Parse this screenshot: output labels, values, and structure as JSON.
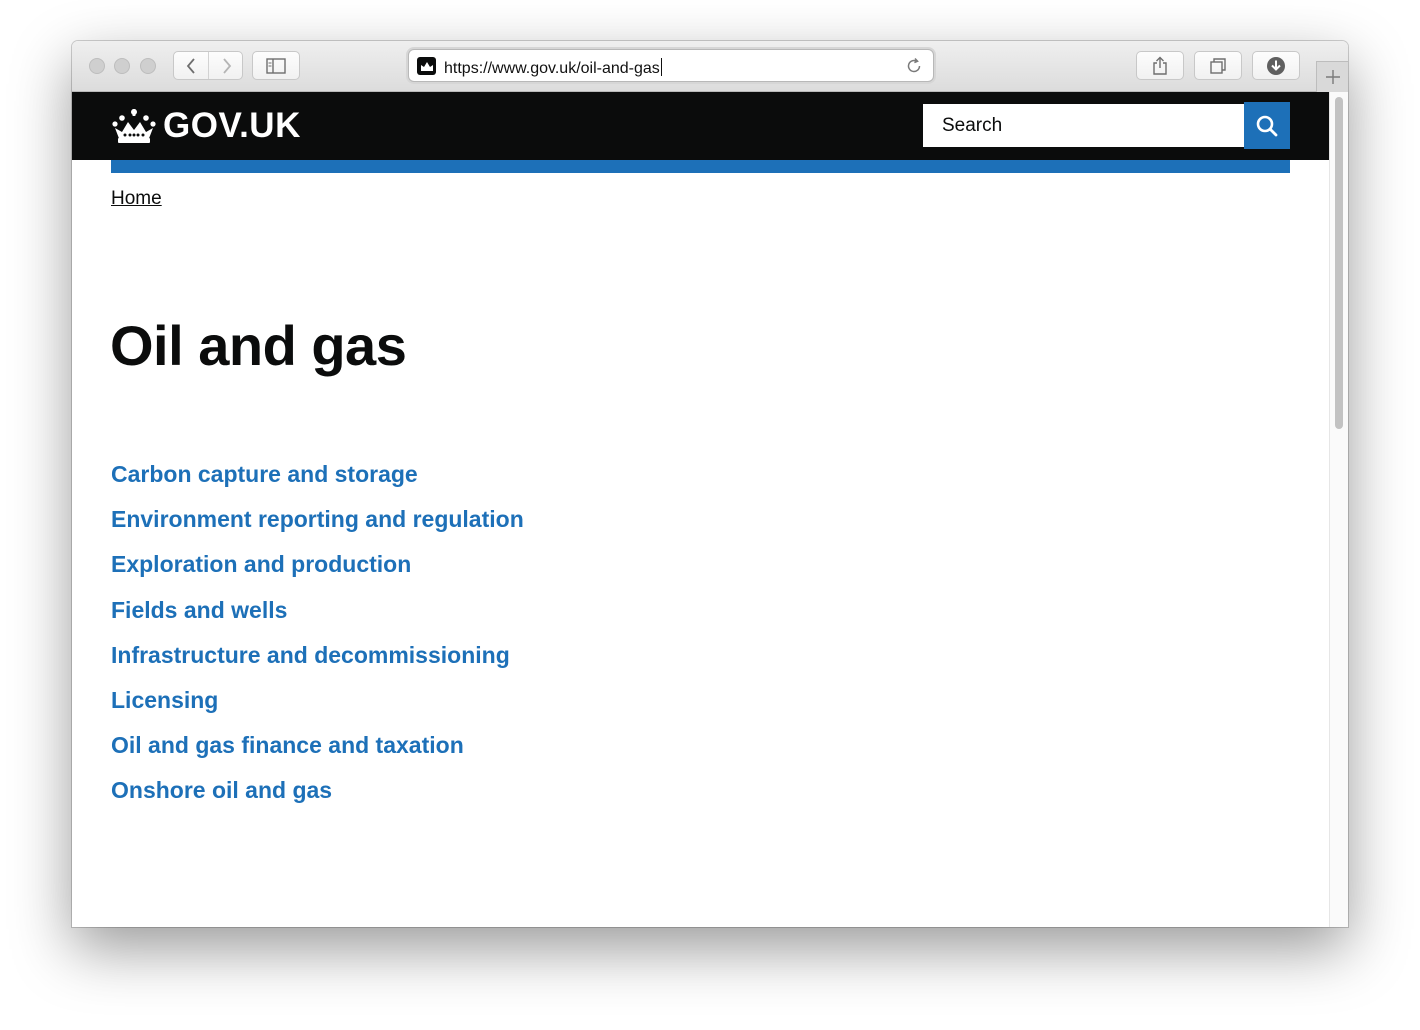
{
  "browser": {
    "url": "https://www.gov.uk/oil-and-gas",
    "icons": {
      "back": "chevron-left-icon",
      "forward": "chevron-right-icon",
      "sidebar": "sidebar-icon",
      "reload": "reload-icon",
      "share": "share-icon",
      "tabs": "tabs-icon",
      "download": "download-icon",
      "new_tab": "plus-icon"
    }
  },
  "header": {
    "logo_text": "GOV.UK",
    "search_placeholder": "Search",
    "colors": {
      "header_bg": "#0b0c0c",
      "accent": "#1d70b8"
    }
  },
  "breadcrumb": {
    "home_label": "Home"
  },
  "main": {
    "title": "Oil and gas",
    "topics": [
      {
        "label": "Carbon capture and storage"
      },
      {
        "label": "Environment reporting and regulation"
      },
      {
        "label": "Exploration and production"
      },
      {
        "label": "Fields and wells"
      },
      {
        "label": "Infrastructure and decommissioning"
      },
      {
        "label": "Licensing"
      },
      {
        "label": "Oil and gas finance and taxation"
      },
      {
        "label": "Onshore oil and gas"
      }
    ]
  }
}
